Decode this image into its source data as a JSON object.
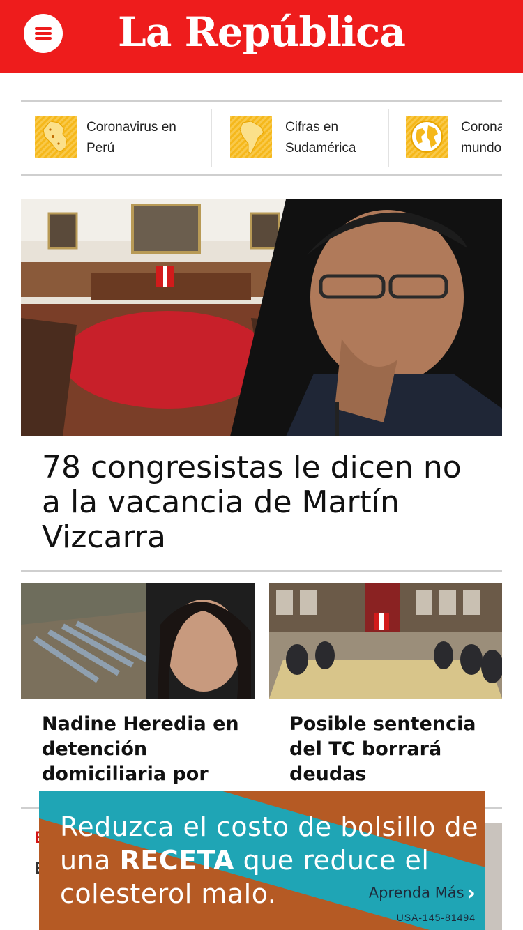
{
  "header": {
    "logo": "La República",
    "brand_color": "#ee1c1c"
  },
  "topics": [
    {
      "label": "Coronavirus en Perú",
      "icon": "peru-map-icon"
    },
    {
      "label": "Cifras en Sudamérica",
      "icon": "south-america-map-icon"
    },
    {
      "label": "Coronavirus en el mundo",
      "icon": "globe-icon"
    }
  ],
  "hero": {
    "title": "78 congresistas le dicen no a la vacancia de Martín Vizcarra"
  },
  "stories": [
    {
      "title": "Nadine Heredia en detención domiciliaria por el…"
    },
    {
      "title": "Posible sentencia del TC borrará deudas tributarias…"
    }
  ],
  "partial": {
    "red_letter": "E",
    "dark_letter": "E"
  },
  "ad": {
    "line_before": "Reduzca el costo de bolsillo de una ",
    "highlight": "RECETA",
    "line_after": " que reduce el colesterol malo.",
    "cta": "Aprenda Más",
    "code": "USA-145-81494",
    "colors": {
      "orange": "#b55a24",
      "teal": "#1fa5b5"
    }
  }
}
